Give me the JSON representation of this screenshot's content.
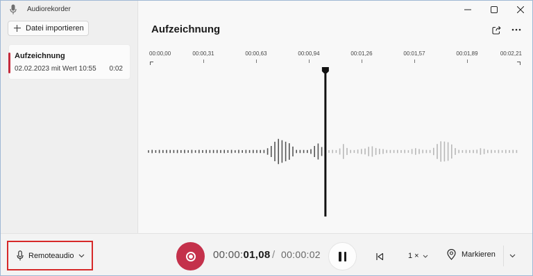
{
  "app": {
    "title": "Audiorekorder",
    "import_label": "Datei importieren"
  },
  "recording_list": [
    {
      "name": "Aufzeichnung",
      "date": "02.02.2023 mit Wert 10:55",
      "duration": "0:02"
    }
  ],
  "main": {
    "title": "Aufzeichnung",
    "timeline_ticks": [
      "00:00,00",
      "00:00,31",
      "00:00,63",
      "00:00,94",
      "00:01,26",
      "00:01,57",
      "00:01,89",
      "00:02,21"
    ],
    "playhead_fraction": 0.48
  },
  "bottom": {
    "input_source": "Remoteaudio",
    "time_current_prefix": "00:00:",
    "time_current_value": "01,08",
    "time_separator": "/",
    "time_total": "00:00:02",
    "speed": "1 ×",
    "mark_label": "Markieren"
  },
  "colors": {
    "accent_red": "#c4314b",
    "highlight_border": "#d62828",
    "played_wave": "#555555",
    "unplayed_wave": "#b8b8b8"
  },
  "icons": {
    "app": "microphone-icon",
    "import": "plus-icon",
    "share": "share-icon",
    "more": "more-dots-icon",
    "input": "microphone-icon",
    "record": "record-icon",
    "pause": "pause-icon",
    "back": "skip-back-icon",
    "mark": "location-pin-icon"
  }
}
